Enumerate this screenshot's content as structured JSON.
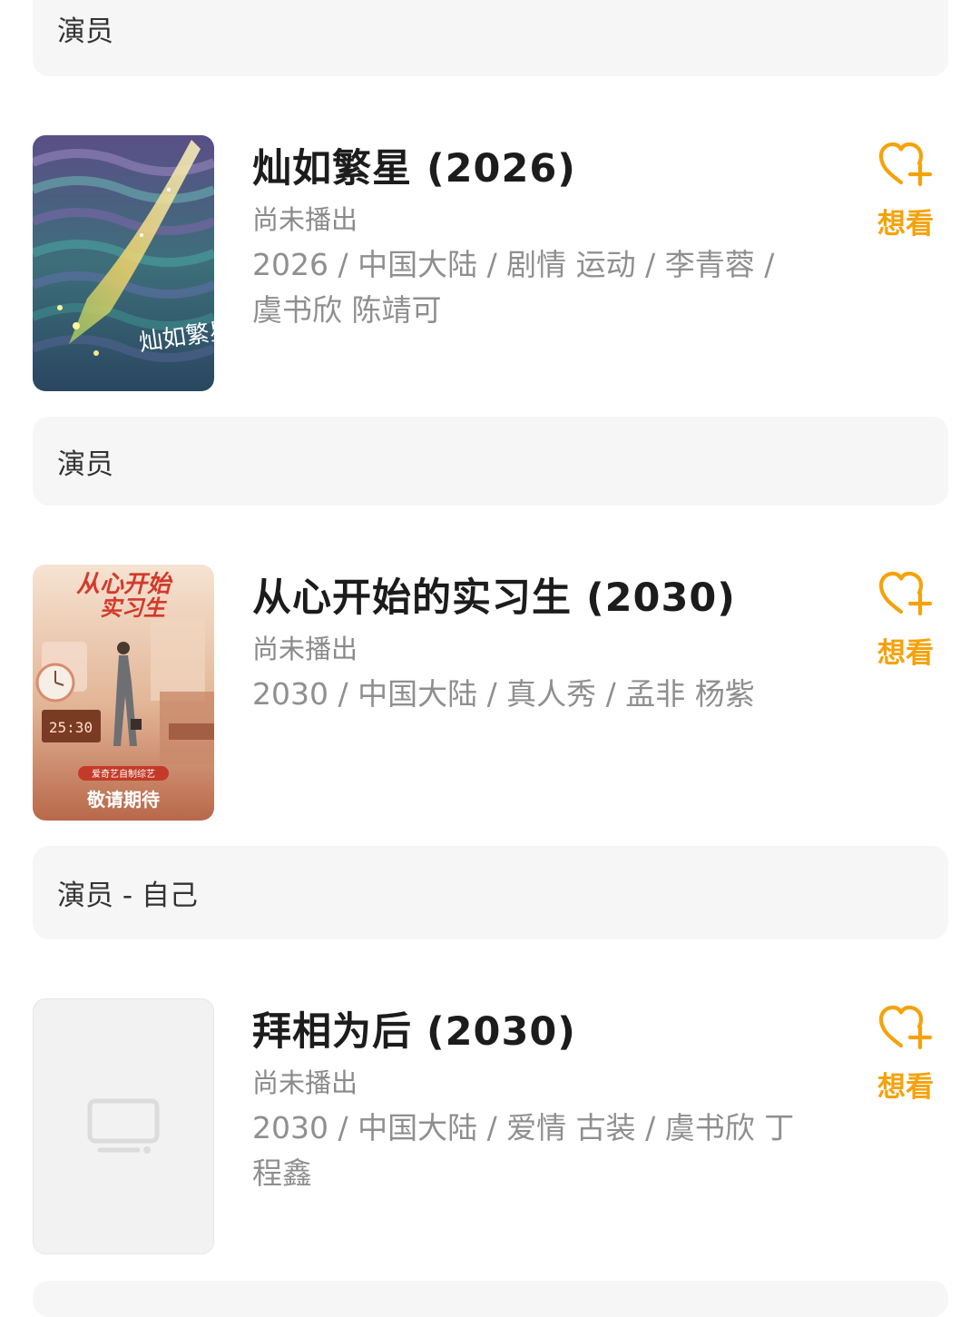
{
  "colors": {
    "accent": "#F5A20A",
    "card_background": "#F6F6F6",
    "secondary_text": "#8F8F8F"
  },
  "role_bars": [
    {
      "label": "演员"
    },
    {
      "label": "演员"
    },
    {
      "label": "演员 - 自己"
    }
  ],
  "items": [
    {
      "title": "灿如繁星 (2026)",
      "status": "尚未播出",
      "meta": "2026 / 中国大陆 / 剧情 运动 / 李青蓉 / 虞书欣 陈靖可",
      "want_label": "想看",
      "poster": {
        "type": "image",
        "title_text": "灿如繁星"
      }
    },
    {
      "title": "从心开始的实习生 (2030)",
      "status": "尚未播出",
      "meta": "2030 / 中国大陆 / 真人秀 / 孟非 杨紫",
      "want_label": "想看",
      "poster": {
        "type": "image",
        "title_text_line1": "从心开始",
        "title_text_line2": "实习生",
        "clock_text": "25:30",
        "tagline": "爱奇艺自制综艺",
        "footer_text": "敬请期待"
      }
    },
    {
      "title": "拜相为后 (2030)",
      "status": "尚未播出",
      "meta": "2030 / 中国大陆 / 爱情 古装 / 虞书欣 丁程鑫",
      "want_label": "想看",
      "poster": {
        "type": "placeholder",
        "icon": "tv-icon"
      }
    }
  ]
}
